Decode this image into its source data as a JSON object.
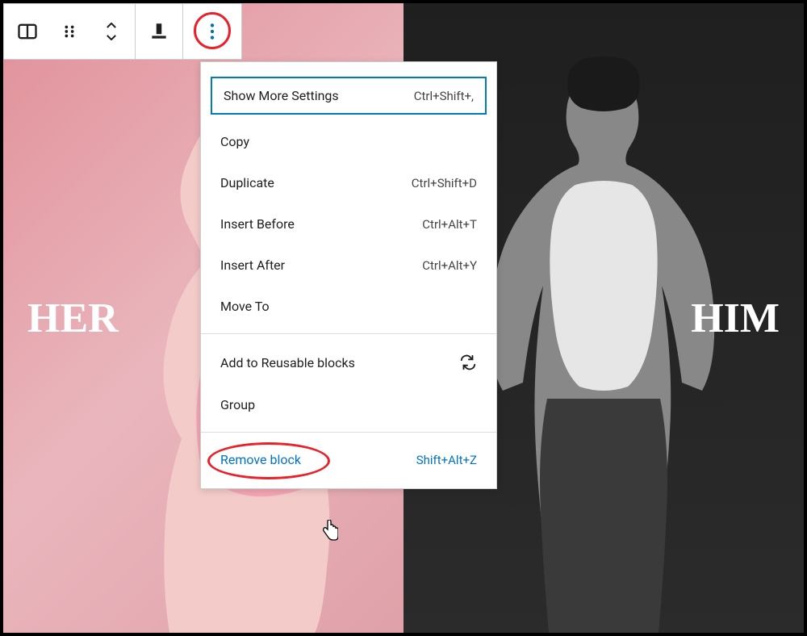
{
  "columns": {
    "her_label": "HER",
    "him_label": "HIM"
  },
  "menu": {
    "show_more": {
      "label": "Show More Settings",
      "shortcut": "Ctrl+Shift+,"
    },
    "copy": {
      "label": "Copy"
    },
    "duplicate": {
      "label": "Duplicate",
      "shortcut": "Ctrl+Shift+D"
    },
    "insert_before": {
      "label": "Insert Before",
      "shortcut": "Ctrl+Alt+T"
    },
    "insert_after": {
      "label": "Insert After",
      "shortcut": "Ctrl+Alt+Y"
    },
    "move_to": {
      "label": "Move To"
    },
    "reusable": {
      "label": "Add to Reusable blocks"
    },
    "group": {
      "label": "Group"
    },
    "remove": {
      "label": "Remove block",
      "shortcut": "Shift+Alt+Z"
    }
  }
}
